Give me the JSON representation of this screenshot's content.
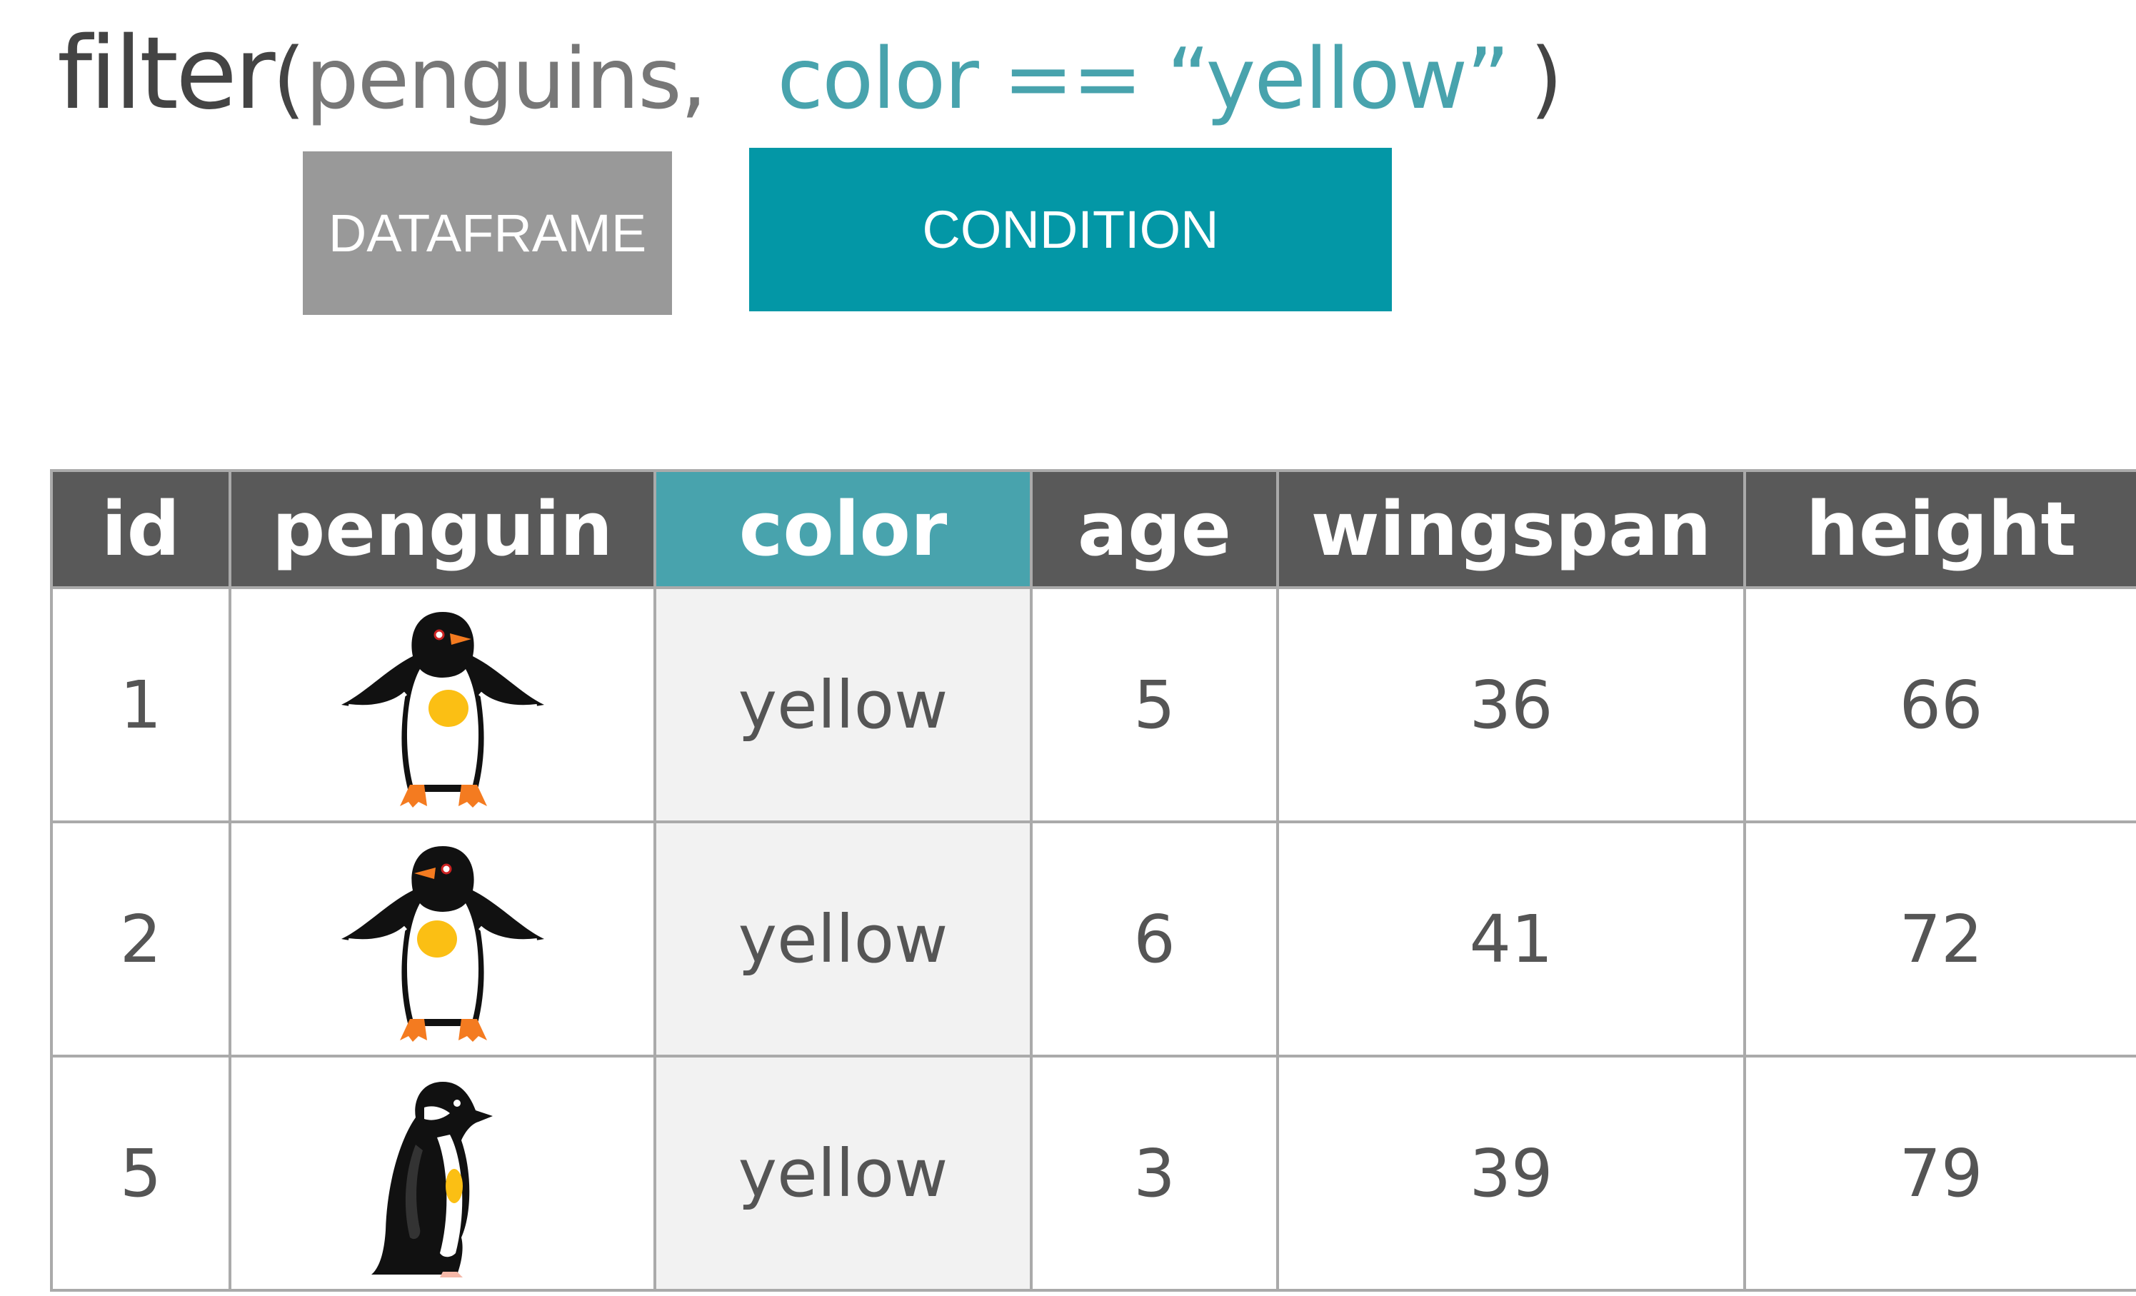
{
  "code": {
    "function_name": "filter",
    "open_paren": "(",
    "dataframe_arg": "penguins,",
    "condition_arg": "color == “yellow”",
    "close_paren": ")"
  },
  "labels": {
    "dataframe": "DATAFRAME",
    "condition": "CONDITION"
  },
  "table": {
    "headers": [
      "id",
      "penguin",
      "color",
      "age",
      "wingspan",
      "height"
    ],
    "highlight_column": "color",
    "rows": [
      {
        "id": "1",
        "penguin": "gentoo-front-icon",
        "color": "yellow",
        "age": "5",
        "wingspan": "36",
        "height": "66"
      },
      {
        "id": "2",
        "penguin": "gentoo-front-icon",
        "color": "yellow",
        "age": "6",
        "wingspan": "41",
        "height": "72"
      },
      {
        "id": "5",
        "penguin": "chinstrap-side-icon",
        "color": "yellow",
        "age": "3",
        "wingspan": "39",
        "height": "79"
      }
    ]
  },
  "colors": {
    "condition_teal": "#0397a6",
    "code_teal": "#48a3ad",
    "header_gray": "#595959",
    "dataframe_gray": "#999999",
    "spot_yellow": "#fbbf14",
    "feet_orange": "#f47b20"
  }
}
